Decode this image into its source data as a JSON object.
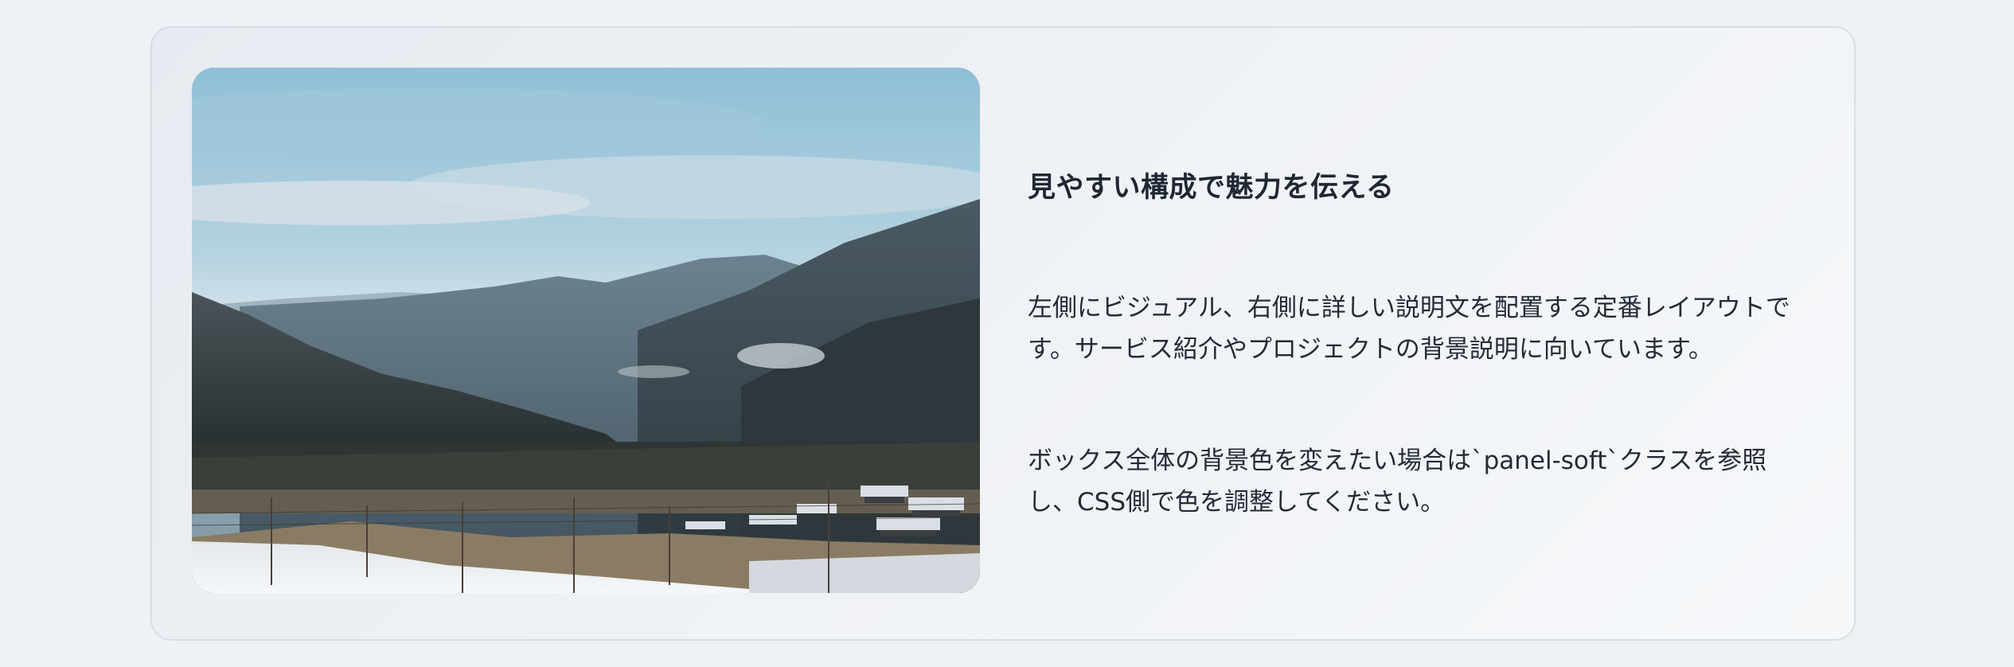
{
  "panel": {
    "heading": "見やすい構成で魅力を伝える",
    "paragraphs": [
      {
        "line1": "左側にビジュアル、右側に詳しい説明文を配置する定番レイアウトで",
        "line2": "す。サービス紹介やプロジェクトの背景説明に向いています。"
      },
      {
        "line1": "ボックス全体の背景色を変えたい場合は`panel-soft`クラスを参照",
        "line2": "し、CSS側で色を調整してください。"
      }
    ],
    "image_icon": "mountain-landscape-photo",
    "colors": {
      "page_background": "#eef1f5",
      "panel_border": "#d8dde5",
      "text": "#232b36",
      "heading": "#1f2733"
    }
  }
}
